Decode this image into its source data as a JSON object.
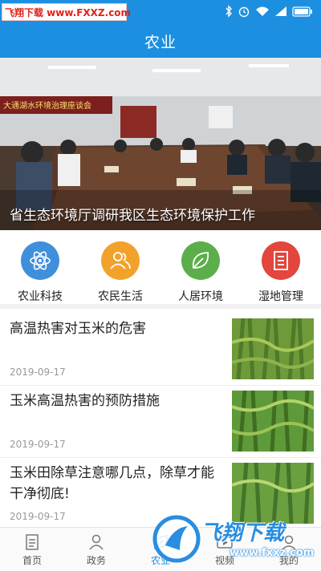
{
  "watermark_top": "飞翔下载 www.FXXZ.com",
  "header": {
    "title": "农业"
  },
  "banner": {
    "caption": "省生态环境厅调研我区生态环境保护工作",
    "sign": "大通湖水环境治理座谈会"
  },
  "categories": [
    {
      "label": "农业科技",
      "icon": "atom-icon",
      "color": "#3f8fdb"
    },
    {
      "label": "农民生活",
      "icon": "people-icon",
      "color": "#f2a22b"
    },
    {
      "label": "人居环境",
      "icon": "leaf-icon",
      "color": "#5cae4a"
    },
    {
      "label": "湿地管理",
      "icon": "document-icon",
      "color": "#e2463c"
    }
  ],
  "news": [
    {
      "title": "高温热害对玉米的危害",
      "date": "2019-09-17"
    },
    {
      "title": "玉米高温热害的预防措施",
      "date": "2019-09-17"
    },
    {
      "title": "玉米田除草注意哪几点，除草才能干净彻底!",
      "date": "2019-09-17"
    }
  ],
  "tabs": [
    {
      "label": "首页",
      "icon": "home-doc-icon"
    },
    {
      "label": "政务",
      "icon": "person-icon"
    },
    {
      "label": "农业",
      "icon": "leaf-icon",
      "active": true
    },
    {
      "label": "视频",
      "icon": "video-icon"
    },
    {
      "label": "我的",
      "icon": "user-icon"
    }
  ],
  "watermark_bottom": {
    "text": "飞翔下载",
    "url": "www.fxxz.com"
  },
  "colors": {
    "primary": "#1d8fe0"
  }
}
